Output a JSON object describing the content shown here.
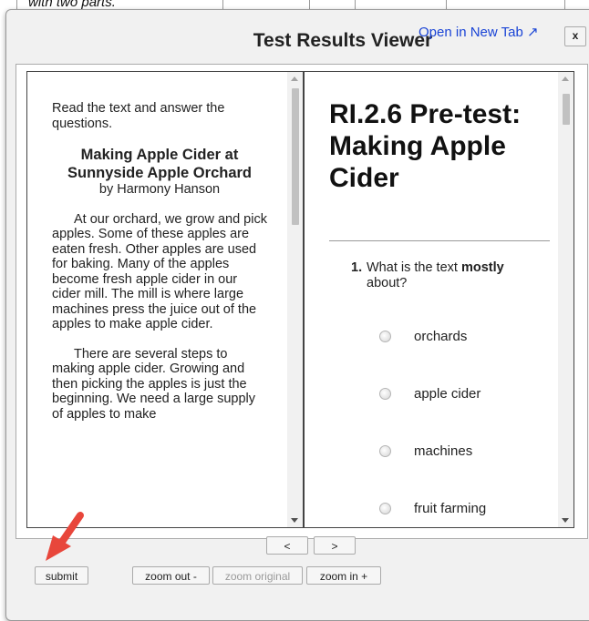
{
  "background": {
    "cell_text": "with two parts."
  },
  "modal": {
    "title": "Test Results Viewer",
    "open_new_tab": "Open in New Tab ↗",
    "close_label": "x"
  },
  "passage": {
    "instructions": "Read the text and answer the questions.",
    "title": "Making Apple Cider at Sunnyside Apple Orchard",
    "author": "by Harmony Hanson",
    "paragraphs": [
      "At our orchard, we grow and pick apples. Some of these apples are eaten fresh. Other apples are used for baking. Many of the apples become fresh apple cider in our cider mill. The mill is where large machines press the juice out of the apples to make apple cider.",
      "There are several steps to making apple cider. Growing and then picking the apples is just the beginning. We need a large supply of apples to make"
    ]
  },
  "test": {
    "title": "RI.2.6 Pre-test: Making Apple Cider",
    "question_number": "1.",
    "question_text_before": "What is the text",
    "question_emphasis": "mostly",
    "question_text_after": "about?",
    "options": [
      "orchards",
      "apple cider",
      "machines",
      "fruit farming"
    ]
  },
  "navigation": {
    "prev_label": "<",
    "next_label": ">"
  },
  "toolbar": {
    "submit_label": "submit",
    "zoom_out_label": "zoom out -",
    "zoom_original_label": "zoom original",
    "zoom_in_label": "zoom in +"
  },
  "colors": {
    "link": "#1a44d6",
    "annotation_arrow": "#e8463b"
  }
}
